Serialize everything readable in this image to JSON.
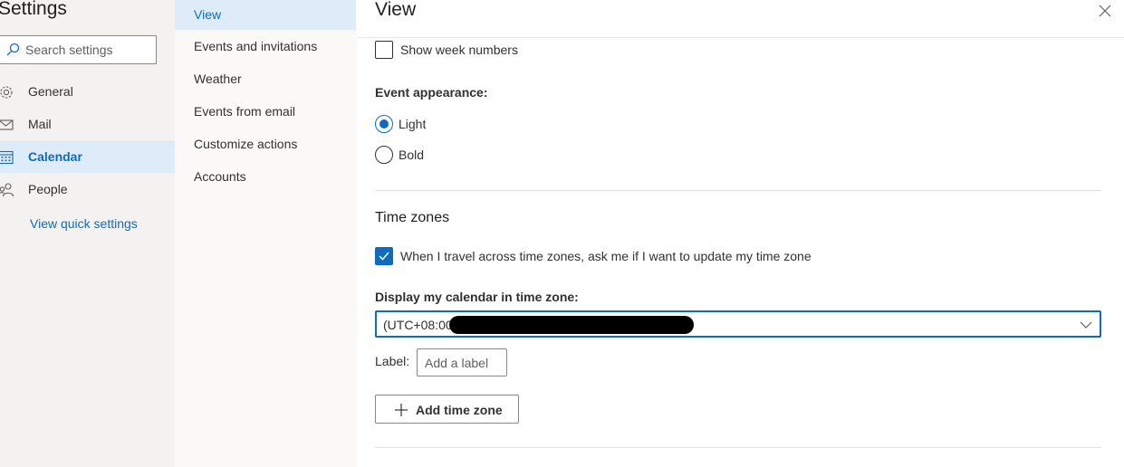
{
  "left_nav": {
    "title": "Settings",
    "search_placeholder": "Search settings",
    "items": [
      {
        "label": "General",
        "icon": "gear-icon"
      },
      {
        "label": "Mail",
        "icon": "mail-icon"
      },
      {
        "label": "Calendar",
        "icon": "calendar-icon",
        "active": true
      },
      {
        "label": "People",
        "icon": "people-icon"
      }
    ],
    "quick_settings_link": "View quick settings"
  },
  "sub_nav": {
    "items": [
      {
        "label": "View",
        "active": true
      },
      {
        "label": "Events and invitations"
      },
      {
        "label": "Weather"
      },
      {
        "label": "Events from email"
      },
      {
        "label": "Customize actions"
      },
      {
        "label": "Accounts"
      }
    ]
  },
  "main": {
    "title": "View",
    "show_week_numbers": {
      "label": "Show week numbers",
      "checked": false
    },
    "event_appearance": {
      "label": "Event appearance:",
      "options": [
        {
          "label": "Light",
          "selected": true
        },
        {
          "label": "Bold",
          "selected": false
        }
      ]
    },
    "time_zones": {
      "title": "Time zones",
      "travel_prompt": {
        "label": "When I travel across time zones, ask me if I want to update my time zone",
        "checked": true
      },
      "display_label": "Display my calendar in time zone:",
      "selected_zone": "(UTC+08:00",
      "label_field": {
        "label": "Label:",
        "placeholder": "Add a label"
      },
      "add_button": "Add time zone"
    }
  },
  "colors": {
    "accent": "#0f6cbd",
    "nav_bg": "#f3f2f1",
    "selected_bg": "#deecf9"
  }
}
